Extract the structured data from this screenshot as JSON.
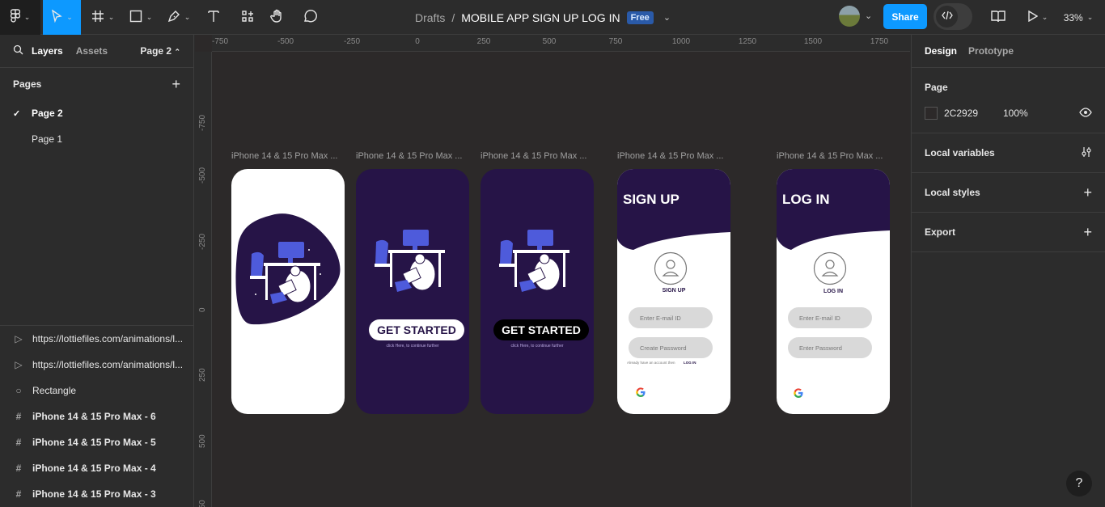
{
  "toolbar": {
    "breadcrumb_parent": "Drafts",
    "breadcrumb_sep": "/",
    "file_title": "MOBILE APP SIGN UP LOG IN",
    "plan_badge": "Free",
    "share_label": "Share",
    "zoom": "33%",
    "accent_color": "#0d99ff"
  },
  "left_panel": {
    "tab_layers": "Layers",
    "tab_assets": "Assets",
    "current_page": "Page 2",
    "pages_title": "Pages",
    "pages": [
      {
        "label": "Page 2",
        "selected": true
      },
      {
        "label": "Page 1",
        "selected": false
      }
    ],
    "layers": [
      {
        "label": "https://lottiefiles.com/animations/l...",
        "icon": "play-icon"
      },
      {
        "label": "https://lottiefiles.com/animations/l...",
        "icon": "play-icon"
      },
      {
        "label": "Rectangle",
        "icon": "circle-icon"
      },
      {
        "label": "iPhone 14 & 15 Pro Max - 6",
        "icon": "frame-icon"
      },
      {
        "label": "iPhone 14 & 15 Pro Max - 5",
        "icon": "frame-icon"
      },
      {
        "label": "iPhone 14 & 15 Pro Max - 4",
        "icon": "frame-icon"
      },
      {
        "label": "iPhone 14 & 15 Pro Max - 3",
        "icon": "frame-icon"
      }
    ]
  },
  "canvas": {
    "background": "#2c2929",
    "ruler_x": [
      "-750",
      "-500",
      "-250",
      "0",
      "250",
      "500",
      "750",
      "1000",
      "1250",
      "1500",
      "1750"
    ],
    "ruler_y": [
      "-750",
      "-500",
      "-250",
      "0",
      "250",
      "500",
      "750"
    ],
    "frames": [
      {
        "label": "iPhone 14 & 15 Pro Max ..."
      },
      {
        "label": "iPhone 14 & 15 Pro Max ...",
        "button": "GET STARTED",
        "sub": "click Here, to continue further"
      },
      {
        "label": "iPhone 14 & 15 Pro Max ...",
        "button": "GET STARTED",
        "sub": "click Here, to continue further"
      },
      {
        "label": "iPhone 14 & 15 Pro Max ...",
        "title": "SIGN UP",
        "avatar_caption": "SIGN UP",
        "email_placeholder": "Enter E-mail ID",
        "password_placeholder": "Create Password",
        "footer_text": "Already have an account then",
        "footer_link": "LOG IN"
      },
      {
        "label": "iPhone 14 & 15 Pro Max ...",
        "title": "LOG IN",
        "avatar_caption": "LOG IN",
        "email_placeholder": "Enter E-mail ID",
        "password_placeholder": "Enter Password"
      }
    ],
    "brand_purple": "#261447"
  },
  "right_panel": {
    "tab_design": "Design",
    "tab_prototype": "Prototype",
    "page_section": "Page",
    "page_color": "2C2929",
    "page_opacity": "100%",
    "local_variables": "Local variables",
    "local_styles": "Local styles",
    "export": "Export"
  },
  "help_label": "?"
}
